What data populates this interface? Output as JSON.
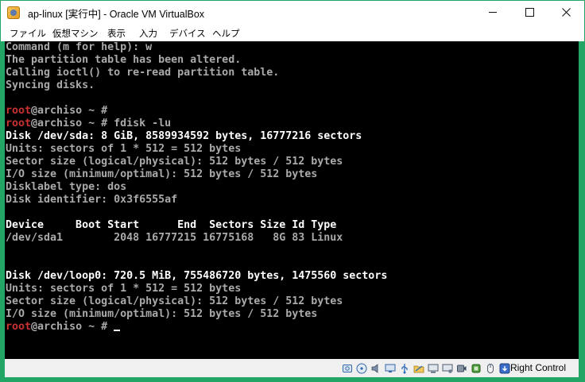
{
  "window": {
    "title": "ap-linux [実行中] - Oracle VM VirtualBox"
  },
  "menu": [
    "ファイル",
    "仮想マシン",
    "表示",
    "入力",
    "デバイス",
    "ヘルプ"
  ],
  "terminal": {
    "lines": [
      [
        {
          "t": "Command (m for help): w"
        }
      ],
      [
        {
          "t": "The partition table has been altered."
        }
      ],
      [
        {
          "t": "Calling ioctl() to re-read partition table."
        }
      ],
      [
        {
          "t": "Syncing disks."
        }
      ],
      [
        {
          "t": ""
        }
      ],
      [
        {
          "t": "root",
          "c": "red"
        },
        {
          "t": "@archiso ~ #"
        }
      ],
      [
        {
          "t": "root",
          "c": "red"
        },
        {
          "t": "@archiso ~ # fdisk -lu"
        }
      ],
      [
        {
          "t": "Disk /dev/sda: 8 GiB, 8589934592 bytes, 16777216 sectors",
          "c": "bright"
        }
      ],
      [
        {
          "t": "Units: sectors of 1 * 512 = 512 bytes"
        }
      ],
      [
        {
          "t": "Sector size (logical/physical): 512 bytes / 512 bytes"
        }
      ],
      [
        {
          "t": "I/O size (minimum/optimal): 512 bytes / 512 bytes"
        }
      ],
      [
        {
          "t": "Disklabel type: dos"
        }
      ],
      [
        {
          "t": "Disk identifier: 0x3f6555af"
        }
      ],
      [
        {
          "t": ""
        }
      ],
      [
        {
          "t": "Device     Boot Start      End  Sectors Size Id Type",
          "c": "bright"
        }
      ],
      [
        {
          "t": "/dev/sda1        2048 16777215 16775168   8G 83 Linux"
        }
      ],
      [
        {
          "t": ""
        }
      ],
      [
        {
          "t": ""
        }
      ],
      [
        {
          "t": "Disk /dev/loop0: 720.5 MiB, 755486720 bytes, 1475560 sectors",
          "c": "bright"
        }
      ],
      [
        {
          "t": "Units: sectors of 1 * 512 = 512 bytes"
        }
      ],
      [
        {
          "t": "Sector size (logical/physical): 512 bytes / 512 bytes"
        }
      ],
      [
        {
          "t": "I/O size (minimum/optimal): 512 bytes / 512 bytes"
        }
      ],
      [
        {
          "t": "root",
          "c": "red"
        },
        {
          "t": "@archiso ~ # "
        },
        {
          "cursor": true
        }
      ]
    ]
  },
  "statusbar": {
    "icons": [
      "hard-disk-icon",
      "optical-drive-icon",
      "audio-icon",
      "network-icon",
      "usb-icon",
      "shared-folders-icon",
      "display-icon",
      "video-capture-icon",
      "recording-icon",
      "cpu-virtualization-icon",
      "mouse-integration-icon",
      "keyboard-capture-icon"
    ],
    "host_key": "Right Control"
  },
  "colors": {
    "frame": "#23a566",
    "terminal_bg": "#000000",
    "terminal_fg": "#aaaaaa",
    "prompt_user": "#c83232"
  }
}
